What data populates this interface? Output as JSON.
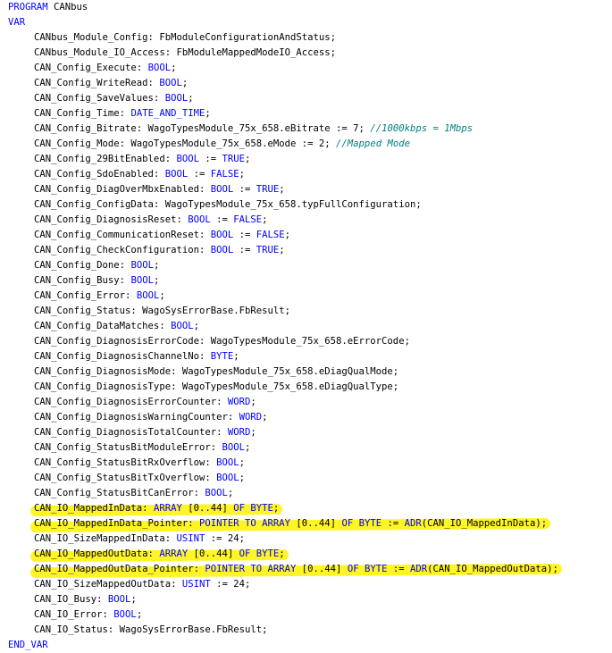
{
  "program_line": [
    {
      "t": "PROGRAM",
      "k": true
    },
    {
      "t": " CANbus"
    }
  ],
  "var_kw": "VAR",
  "end_var_kw": "END_VAR",
  "lines": [
    [
      {
        "t": "CANbus_Module_Config: FbModuleConfigurationAndStatus;"
      }
    ],
    [
      {
        "t": "CANbus_Module_IO_Access: FbModuleMappedModeIO_Access;"
      }
    ],
    [
      {
        "t": "CAN_Config_Execute: "
      },
      {
        "t": "BOOL",
        "k": true
      },
      {
        "t": ";"
      }
    ],
    [
      {
        "t": "CAN_Config_WriteRead: "
      },
      {
        "t": "BOOL",
        "k": true
      },
      {
        "t": ";"
      }
    ],
    [
      {
        "t": "CAN_Config_SaveValues: "
      },
      {
        "t": "BOOL",
        "k": true
      },
      {
        "t": ";"
      }
    ],
    [
      {
        "t": "CAN_Config_Time: "
      },
      {
        "t": "DATE_AND_TIME",
        "k": true
      },
      {
        "t": ";"
      }
    ],
    [
      {
        "t": "CAN_Config_Bitrate: WagoTypesModule_75x_658.eBitrate := 7; "
      },
      {
        "t": "//1000kbps = 1Mbps",
        "c": true
      }
    ],
    [
      {
        "t": "CAN_Config_Mode: WagoTypesModule_75x_658.eMode := 2; "
      },
      {
        "t": "//Mapped Mode",
        "c": true
      }
    ],
    [
      {
        "t": "CAN_Config_29BitEnabled: "
      },
      {
        "t": "BOOL",
        "k": true
      },
      {
        "t": " := "
      },
      {
        "t": "TRUE",
        "k": true
      },
      {
        "t": ";"
      }
    ],
    [
      {
        "t": "CAN_Config_SdoEnabled: "
      },
      {
        "t": "BOOL",
        "k": true
      },
      {
        "t": " := "
      },
      {
        "t": "FALSE",
        "k": true
      },
      {
        "t": ";"
      }
    ],
    [
      {
        "t": "CAN_Config_DiagOverMbxEnabled: "
      },
      {
        "t": "BOOL",
        "k": true
      },
      {
        "t": " := "
      },
      {
        "t": "TRUE",
        "k": true
      },
      {
        "t": ";"
      }
    ],
    [
      {
        "t": "CAN_Config_ConfigData: WagoTypesModule_75x_658.typFullConfiguration;"
      }
    ],
    [
      {
        "t": "CAN_Config_DiagnosisReset: "
      },
      {
        "t": "BOOL",
        "k": true
      },
      {
        "t": " := "
      },
      {
        "t": "FALSE",
        "k": true
      },
      {
        "t": ";"
      }
    ],
    [
      {
        "t": "CAN_Config_CommunicationReset: "
      },
      {
        "t": "BOOL",
        "k": true
      },
      {
        "t": " := "
      },
      {
        "t": "FALSE",
        "k": true
      },
      {
        "t": ";"
      }
    ],
    [
      {
        "t": "CAN_Config_CheckConfiguration: "
      },
      {
        "t": "BOOL",
        "k": true
      },
      {
        "t": " := "
      },
      {
        "t": "TRUE",
        "k": true
      },
      {
        "t": ";"
      }
    ],
    [
      {
        "t": "CAN_Config_Done: "
      },
      {
        "t": "BOOL",
        "k": true
      },
      {
        "t": ";"
      }
    ],
    [
      {
        "t": "CAN_Config_Busy: "
      },
      {
        "t": "BOOL",
        "k": true
      },
      {
        "t": ";"
      }
    ],
    [
      {
        "t": "CAN_Config_Error: "
      },
      {
        "t": "BOOL",
        "k": true
      },
      {
        "t": ";"
      }
    ],
    [
      {
        "t": "CAN_Config_Status: WagoSysErrorBase.FbResult;"
      }
    ],
    [
      {
        "t": "CAN_Config_DataMatches: "
      },
      {
        "t": "BOOL",
        "k": true
      },
      {
        "t": ";"
      }
    ],
    [
      {
        "t": "CAN_Config_DiagnosisErrorCode: WagoTypesModule_75x_658.eErrorCode;"
      }
    ],
    [
      {
        "t": "CAN_Config_DiagnosisChannelNo: "
      },
      {
        "t": "BYTE",
        "k": true
      },
      {
        "t": ";"
      }
    ],
    [
      {
        "t": "CAN_Config_DiagnosisMode: WagoTypesModule_75x_658.eDiagQualMode;"
      }
    ],
    [
      {
        "t": "CAN_Config_DiagnosisType: WagoTypesModule_75x_658.eDiagQualType;"
      }
    ],
    [
      {
        "t": "CAN_Config_DiagnosisErrorCounter: "
      },
      {
        "t": "WORD",
        "k": true
      },
      {
        "t": ";"
      }
    ],
    [
      {
        "t": "CAN_Config_DiagnosisWarningCounter: "
      },
      {
        "t": "WORD",
        "k": true
      },
      {
        "t": ";"
      }
    ],
    [
      {
        "t": "CAN_Config_DiagnosisTotalCounter: "
      },
      {
        "t": "WORD",
        "k": true
      },
      {
        "t": ";"
      }
    ],
    [
      {
        "t": "CAN_Config_StatusBitModuleError: "
      },
      {
        "t": "BOOL",
        "k": true
      },
      {
        "t": ";"
      }
    ],
    [
      {
        "t": "CAN_Config_StatusBitRxOverflow: "
      },
      {
        "t": "BOOL",
        "k": true
      },
      {
        "t": ";"
      }
    ],
    [
      {
        "t": "CAN_Config_StatusBitTxOverflow: "
      },
      {
        "t": "BOOL",
        "k": true
      },
      {
        "t": ";"
      }
    ],
    [
      {
        "t": "CAN_Config_StatusBitCanError: "
      },
      {
        "t": "BOOL",
        "k": true
      },
      {
        "t": ";"
      }
    ],
    [
      {
        "t": "CAN_IO_MappedInData: "
      },
      {
        "t": "ARRAY",
        "k": true
      },
      {
        "t": " [0..44] "
      },
      {
        "t": "OF",
        "k": true
      },
      {
        "t": " "
      },
      {
        "t": "BYTE",
        "k": true
      },
      {
        "t": ";"
      }
    ],
    [
      {
        "t": "CAN_IO_MappedInData_Pointer: "
      },
      {
        "t": "POINTER TO ARRAY",
        "k": true
      },
      {
        "t": " [0..44] "
      },
      {
        "t": "OF",
        "k": true
      },
      {
        "t": " "
      },
      {
        "t": "BYTE",
        "k": true
      },
      {
        "t": " := "
      },
      {
        "t": "ADR",
        "k": true
      },
      {
        "t": "(CAN_IO_MappedInData);"
      }
    ],
    [
      {
        "t": "CAN_IO_SizeMappedInData: "
      },
      {
        "t": "USINT",
        "k": true
      },
      {
        "t": " := 24;"
      }
    ],
    [
      {
        "t": "CAN_IO_MappedOutData: "
      },
      {
        "t": "ARRAY",
        "k": true
      },
      {
        "t": " [0..44] "
      },
      {
        "t": "OF",
        "k": true
      },
      {
        "t": " "
      },
      {
        "t": "BYTE",
        "k": true
      },
      {
        "t": ";"
      }
    ],
    [
      {
        "t": "CAN_IO_MappedOutData_Pointer: "
      },
      {
        "t": "POINTER TO ARRAY",
        "k": true
      },
      {
        "t": " [0..44] "
      },
      {
        "t": "OF",
        "k": true
      },
      {
        "t": " "
      },
      {
        "t": "BYTE",
        "k": true
      },
      {
        "t": " := "
      },
      {
        "t": "ADR",
        "k": true
      },
      {
        "t": "(CAN_IO_MappedOutData);"
      }
    ],
    [
      {
        "t": "CAN_IO_SizeMappedOutData: "
      },
      {
        "t": "USINT",
        "k": true
      },
      {
        "t": " := 24;"
      }
    ],
    [
      {
        "t": "CAN_IO_Busy: "
      },
      {
        "t": "BOOL",
        "k": true
      },
      {
        "t": ";"
      }
    ],
    [
      {
        "t": "CAN_IO_Error: "
      },
      {
        "t": "BOOL",
        "k": true
      },
      {
        "t": ";"
      }
    ],
    [
      {
        "t": "CAN_IO_Status: WagoSysErrorBase.FbResult;"
      }
    ]
  ],
  "highlighted_lines": [
    31,
    32,
    34,
    35
  ],
  "colors": {
    "keyword": "#0000ff",
    "comment": "#008080",
    "text": "#000000",
    "highlight": "#fff200"
  }
}
